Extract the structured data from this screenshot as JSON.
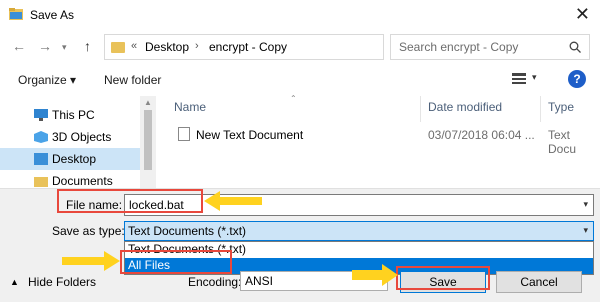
{
  "window": {
    "title": "Save As",
    "close_glyph": "✕"
  },
  "address": {
    "overflow": "«",
    "crumbs": [
      "Desktop",
      "encrypt - Copy"
    ],
    "separator": "›",
    "search_placeholder": "Search encrypt - Copy"
  },
  "toolbar": {
    "organize": "Organize ▾",
    "new_folder": "New folder",
    "help": "?"
  },
  "nav": {
    "items": [
      {
        "label": "This PC",
        "icon": "computer-icon"
      },
      {
        "label": "3D Objects",
        "icon": "cube-icon"
      },
      {
        "label": "Desktop",
        "icon": "desktop-icon"
      },
      {
        "label": "Documents",
        "icon": "folder-icon"
      }
    ]
  },
  "files": {
    "columns": [
      "Name",
      "Date modified",
      "Type"
    ],
    "rows": [
      {
        "name": "New Text Document",
        "date": "03/07/2018 06:04 ...",
        "type": "Text Docu"
      }
    ]
  },
  "form": {
    "file_name_label": "File name:",
    "file_name_value": "locked.bat",
    "save_as_type_label": "Save as type:",
    "save_as_type_value": "Text Documents (*.txt)",
    "type_options": [
      "Text Documents (*.txt)",
      "All Files"
    ],
    "encoding_label": "Encoding:",
    "encoding_value": "ANSI"
  },
  "footer": {
    "hide_folders": "Hide Folders",
    "save": "Save",
    "cancel": "Cancel"
  },
  "colors": {
    "highlight_box": "#e8483c",
    "arrow": "#ffd21f",
    "selection": "#0078d7"
  }
}
